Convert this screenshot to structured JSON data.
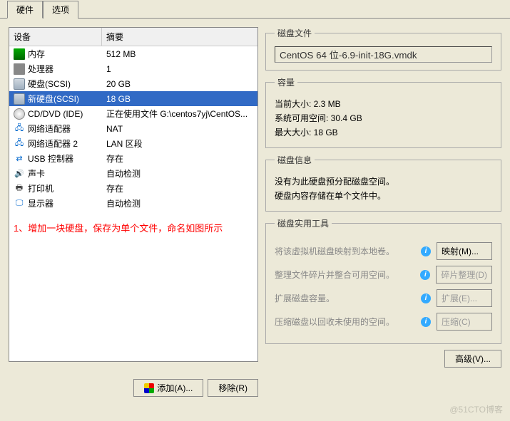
{
  "tabs": {
    "hardware": "硬件",
    "options": "选项"
  },
  "table": {
    "head": {
      "device": "设备",
      "summary": "摘要"
    },
    "rows": [
      {
        "icon": "ic-mem",
        "iconName": "memory-icon",
        "device": "内存",
        "summary": "512 MB"
      },
      {
        "icon": "ic-cpu",
        "iconName": "cpu-icon",
        "device": "处理器",
        "summary": "1"
      },
      {
        "icon": "ic-hd",
        "iconName": "harddisk-icon",
        "device": "硬盘(SCSI)",
        "summary": "20 GB"
      },
      {
        "icon": "ic-hd",
        "iconName": "harddisk-icon",
        "device": "新硬盘(SCSI)",
        "summary": "18 GB",
        "selected": true
      },
      {
        "icon": "ic-cd",
        "iconName": "cdrom-icon",
        "device": "CD/DVD (IDE)",
        "summary": "正在使用文件 G:\\centos7yj\\CentOS..."
      },
      {
        "icon": "ic-net",
        "iconName": "network-icon",
        "glyph": "🖧",
        "device": "网络适配器",
        "summary": "NAT"
      },
      {
        "icon": "ic-net",
        "iconName": "network-icon",
        "glyph": "🖧",
        "device": "网络适配器 2",
        "summary": "LAN 区段"
      },
      {
        "icon": "ic-usb",
        "iconName": "usb-icon",
        "glyph": "⇄",
        "device": "USB 控制器",
        "summary": "存在"
      },
      {
        "icon": "ic-snd",
        "iconName": "sound-icon",
        "glyph": "🔊",
        "device": "声卡",
        "summary": "自动检测"
      },
      {
        "icon": "ic-prn",
        "iconName": "printer-icon",
        "glyph": "🖶",
        "device": "打印机",
        "summary": "存在"
      },
      {
        "icon": "ic-dsp",
        "iconName": "display-icon",
        "glyph": "🖵",
        "device": "显示器",
        "summary": "自动检测"
      }
    ]
  },
  "annotation": "1、增加一块硬盘，保存为单个文件，命名如图所示",
  "buttons": {
    "add": "添加(A)...",
    "remove": "移除(R)",
    "advanced": "高级(V)..."
  },
  "sections": {
    "diskFile": {
      "legend": "磁盘文件",
      "value": "CentOS 64 位-6.9-init-18G.vmdk"
    },
    "capacity": {
      "legend": "容量",
      "current": "当前大小: 2.3 MB",
      "free": "系统可用空间: 30.4 GB",
      "max": "最大大小: 18 GB"
    },
    "diskInfo": {
      "legend": "磁盘信息",
      "line1": "没有为此硬盘预分配磁盘空间。",
      "line2": "硬盘内容存储在单个文件中。"
    },
    "utils": {
      "legend": "磁盘实用工具",
      "map": {
        "text": "将该虚拟机磁盘映射到本地卷。",
        "btn": "映射(M)..."
      },
      "defrag": {
        "text": "整理文件碎片并整合可用空间。",
        "btn": "碎片整理(D)"
      },
      "expand": {
        "text": "扩展磁盘容量。",
        "btn": "扩展(E)..."
      },
      "compact": {
        "text": "压缩磁盘以回收未使用的空间。",
        "btn": "压缩(C)"
      }
    }
  },
  "watermark": "@51CTO博客"
}
